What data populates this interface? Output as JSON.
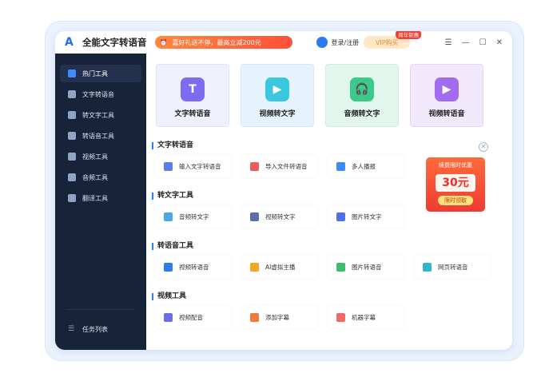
{
  "app": {
    "title": "全能文字转语音",
    "promo": "嘉好礼送不停，最高立减200元",
    "login": "登录/注册",
    "vip": "VIP购买",
    "vip_badge": "周年钜惠"
  },
  "sidebar": {
    "items": [
      {
        "label": "热门工具"
      },
      {
        "label": "文字转语音"
      },
      {
        "label": "转文字工具"
      },
      {
        "label": "转语音工具"
      },
      {
        "label": "视频工具"
      },
      {
        "label": "音频工具"
      },
      {
        "label": "翻译工具"
      }
    ],
    "tasks": "任务列表"
  },
  "cards": [
    {
      "label": "文字转语音",
      "icon": "T"
    },
    {
      "label": "视频转文字",
      "icon": "▶"
    },
    {
      "label": "音频转文字",
      "icon": "🎧"
    },
    {
      "label": "视频转语音",
      "icon": "▶"
    }
  ],
  "sections": [
    {
      "title": "文字转语音",
      "tools": [
        "输入文字转语音",
        "导入文件转语音",
        "多人播报"
      ]
    },
    {
      "title": "转文字工具",
      "tools": [
        "音频转文字",
        "视频转文字",
        "图片转文字"
      ]
    },
    {
      "title": "转语音工具",
      "tools": [
        "视频转语音",
        "AI虚拟主播",
        "图片转语音",
        "网页转语音"
      ]
    },
    {
      "title": "视频工具",
      "tools": [
        "视频配音",
        "添加字幕",
        "机器字幕"
      ]
    }
  ],
  "ad": {
    "title": "续费限时优惠",
    "value": "30元",
    "button": "限时领取"
  }
}
